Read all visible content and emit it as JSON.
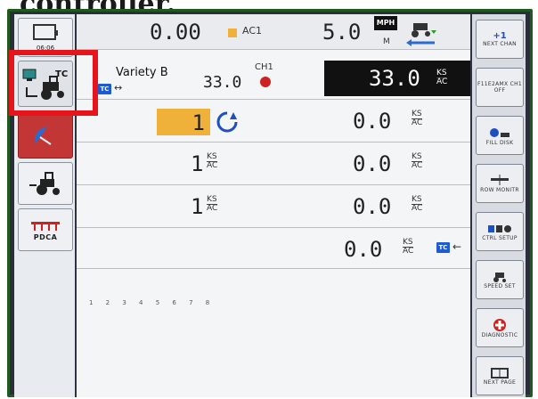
{
  "heading": "controller.",
  "left_sidebar": {
    "clock": "06:06",
    "tc_label": "TC",
    "pdca_label": "PDCA"
  },
  "top_bar": {
    "value_left": "0.00",
    "ac_label": "AC1",
    "speed": "5.0",
    "speed_unit": "MPH",
    "speed_unit_sub": "M"
  },
  "row_ch1": {
    "variety": "Variety B",
    "channel": "CH1",
    "target_rate": "33.0",
    "actual_rate": "33.0",
    "unit_num": "KS",
    "unit_den": "AC"
  },
  "rows": [
    {
      "left_value": "1",
      "right_value": "0.0",
      "unit_num": "KS",
      "unit_den": "AC"
    },
    {
      "left_value": "1",
      "left_unit_num": "KS",
      "left_unit_den": "AC",
      "right_value": "0.0",
      "unit_num": "KS",
      "unit_den": "AC"
    },
    {
      "left_value": "1",
      "left_unit_num": "KS",
      "left_unit_den": "AC",
      "right_value": "0.0",
      "unit_num": "KS",
      "unit_den": "AC"
    }
  ],
  "total_row": {
    "value": "0.0",
    "unit_num": "KS",
    "unit_den": "AC"
  },
  "row_numbers": "1 2 3 4 5 6 7 8",
  "right_sidebar": {
    "buttons": [
      {
        "top": "+1",
        "label": "NEXT CHAN"
      },
      {
        "top": "",
        "label": "F11E2AMX CH1 OFF"
      },
      {
        "top": "",
        "label": "FILL DISK"
      },
      {
        "top": "",
        "label": "ROW MONITR"
      },
      {
        "top": "",
        "label": "CTRL SETUP"
      },
      {
        "top": "",
        "label": "SPEED SET"
      },
      {
        "top": "",
        "label": "DIAGNOSTIC"
      },
      {
        "top": "",
        "label": "NEXT PAGE"
      }
    ]
  },
  "colors": {
    "highlight": "#e8141b",
    "rate_bg": "#f0b13a",
    "tc_blue": "#1f5bd0",
    "green_frame": "#1f5a1f"
  }
}
